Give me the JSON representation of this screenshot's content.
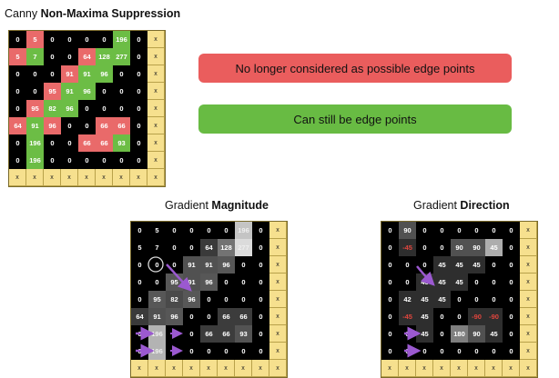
{
  "titles": {
    "nms_prefix": "Canny ",
    "nms_bold": "Non-Maxima Suppression",
    "mag_prefix": "Gradient ",
    "mag_bold": "Magnitude",
    "dir_prefix": "Gradient ",
    "dir_bold": "Direction"
  },
  "legend": {
    "suppressed_label": "No longer considered as possible edge points",
    "kept_label": "Can still be edge points",
    "suppressed_color": "#ea5d5d",
    "kept_color": "#68bb43"
  },
  "nms_grid": [
    [
      "0",
      "5",
      "0",
      "0",
      "0",
      "0",
      "196",
      "0",
      "x"
    ],
    [
      "5",
      "7",
      "0",
      "0",
      "64",
      "128",
      "277",
      "0",
      "x"
    ],
    [
      "0",
      "0",
      "0",
      "91",
      "91",
      "96",
      "0",
      "0",
      "x"
    ],
    [
      "0",
      "0",
      "95",
      "91",
      "96",
      "0",
      "0",
      "0",
      "x"
    ],
    [
      "0",
      "95",
      "82",
      "96",
      "0",
      "0",
      "0",
      "0",
      "x"
    ],
    [
      "64",
      "91",
      "96",
      "0",
      "0",
      "66",
      "66",
      "0",
      "x"
    ],
    [
      "0",
      "196",
      "0",
      "0",
      "66",
      "66",
      "93",
      "0",
      "x"
    ],
    [
      "0",
      "196",
      "0",
      "0",
      "0",
      "0",
      "0",
      "0",
      "x"
    ],
    [
      "x",
      "x",
      "x",
      "x",
      "x",
      "x",
      "x",
      "x",
      "x"
    ]
  ],
  "nms_status": [
    [
      "k",
      "r",
      "k",
      "k",
      "k",
      "k",
      "g",
      "k",
      "x"
    ],
    [
      "r",
      "g",
      "k",
      "k",
      "r",
      "g",
      "g",
      "k",
      "x"
    ],
    [
      "k",
      "k",
      "k",
      "r",
      "g",
      "g",
      "k",
      "k",
      "x"
    ],
    [
      "k",
      "k",
      "r",
      "g",
      "g",
      "k",
      "k",
      "k",
      "x"
    ],
    [
      "k",
      "r",
      "g",
      "g",
      "k",
      "k",
      "k",
      "k",
      "x"
    ],
    [
      "r",
      "g",
      "r",
      "k",
      "k",
      "r",
      "r",
      "k",
      "x"
    ],
    [
      "k",
      "g",
      "k",
      "k",
      "r",
      "r",
      "g",
      "k",
      "x"
    ],
    [
      "k",
      "g",
      "k",
      "k",
      "k",
      "k",
      "k",
      "k",
      "x"
    ],
    [
      "x",
      "x",
      "x",
      "x",
      "x",
      "x",
      "x",
      "x",
      "x"
    ]
  ],
  "magnitude_grid": [
    [
      "0",
      "5",
      "0",
      "0",
      "0",
      "0",
      "196",
      "0",
      "x"
    ],
    [
      "5",
      "7",
      "0",
      "0",
      "64",
      "128",
      "277",
      "0",
      "x"
    ],
    [
      "0",
      "0",
      "0",
      "91",
      "91",
      "96",
      "0",
      "0",
      "x"
    ],
    [
      "0",
      "0",
      "95",
      "91",
      "96",
      "0",
      "0",
      "0",
      "x"
    ],
    [
      "0",
      "95",
      "82",
      "96",
      "0",
      "0",
      "0",
      "0",
      "x"
    ],
    [
      "64",
      "91",
      "96",
      "0",
      "0",
      "66",
      "66",
      "0",
      "x"
    ],
    [
      "0",
      "196",
      "0",
      "0",
      "66",
      "66",
      "93",
      "0",
      "x"
    ],
    [
      "0",
      "196",
      "0",
      "0",
      "0",
      "0",
      "0",
      "0",
      "x"
    ],
    [
      "x",
      "x",
      "x",
      "x",
      "x",
      "x",
      "x",
      "x",
      "x"
    ]
  ],
  "magnitude_shade": [
    [
      0,
      0,
      0,
      0,
      0,
      0,
      0.85,
      0,
      -1
    ],
    [
      0,
      0,
      0,
      0,
      0.25,
      0.5,
      0.95,
      0,
      -1
    ],
    [
      0,
      0,
      0,
      0.35,
      0.35,
      0.38,
      0,
      0,
      -1
    ],
    [
      0,
      0,
      0.38,
      0.35,
      0.38,
      0,
      0,
      0,
      -1
    ],
    [
      0,
      0.38,
      0.32,
      0.38,
      0,
      0,
      0,
      0,
      -1
    ],
    [
      0.25,
      0.35,
      0.38,
      0,
      0,
      0.26,
      0.26,
      0,
      -1
    ],
    [
      0,
      0.78,
      0,
      0,
      0.26,
      0.26,
      0.36,
      0,
      -1
    ],
    [
      0,
      0.78,
      0,
      0,
      0,
      0,
      0,
      0,
      -1
    ],
    [
      -1,
      -1,
      -1,
      -1,
      -1,
      -1,
      -1,
      -1,
      -1
    ]
  ],
  "direction_grid": [
    [
      "0",
      "90",
      "0",
      "0",
      "0",
      "0",
      "0",
      "0",
      "x"
    ],
    [
      "0",
      "-45",
      "0",
      "0",
      "90",
      "90",
      "45",
      "0",
      "x"
    ],
    [
      "0",
      "0",
      "0",
      "45",
      "45",
      "45",
      "0",
      "0",
      "x"
    ],
    [
      "0",
      "0",
      "45",
      "45",
      "45",
      "0",
      "0",
      "0",
      "x"
    ],
    [
      "0",
      "42",
      "45",
      "45",
      "0",
      "0",
      "0",
      "0",
      "x"
    ],
    [
      "0",
      "-45",
      "45",
      "0",
      "0",
      "-90",
      "-90",
      "0",
      "x"
    ],
    [
      "0",
      "0",
      "45",
      "0",
      "180",
      "90",
      "45",
      "0",
      "x"
    ],
    [
      "0",
      "0",
      "0",
      "0",
      "0",
      "0",
      "0",
      "0",
      "x"
    ],
    [
      "x",
      "x",
      "x",
      "x",
      "x",
      "x",
      "x",
      "x",
      "x"
    ]
  ],
  "direction_shade": [
    [
      0,
      0.35,
      0,
      0,
      0,
      0,
      0,
      0,
      -1
    ],
    [
      0,
      0.2,
      0,
      0,
      0.35,
      0.35,
      0.75,
      0,
      -1
    ],
    [
      0,
      0,
      0,
      0.2,
      0.2,
      0.2,
      0,
      0,
      -1
    ],
    [
      0,
      0,
      0.2,
      0.2,
      0.2,
      0,
      0,
      0,
      -1
    ],
    [
      0,
      0.2,
      0.2,
      0.2,
      0,
      0,
      0,
      0,
      -1
    ],
    [
      0,
      0.2,
      0.2,
      0,
      0,
      0.2,
      0.2,
      0,
      -1
    ],
    [
      0,
      0,
      0.2,
      0,
      0.55,
      0.35,
      0.2,
      0,
      -1
    ],
    [
      0,
      0,
      0,
      0,
      0,
      0,
      0,
      0,
      -1
    ],
    [
      -1,
      -1,
      -1,
      -1,
      -1,
      -1,
      -1,
      -1,
      -1
    ]
  ],
  "direction_red_cells": [
    [
      1,
      1
    ],
    [
      5,
      1
    ],
    [
      5,
      5
    ],
    [
      5,
      6
    ]
  ],
  "arrow_color": "#9b59d0"
}
